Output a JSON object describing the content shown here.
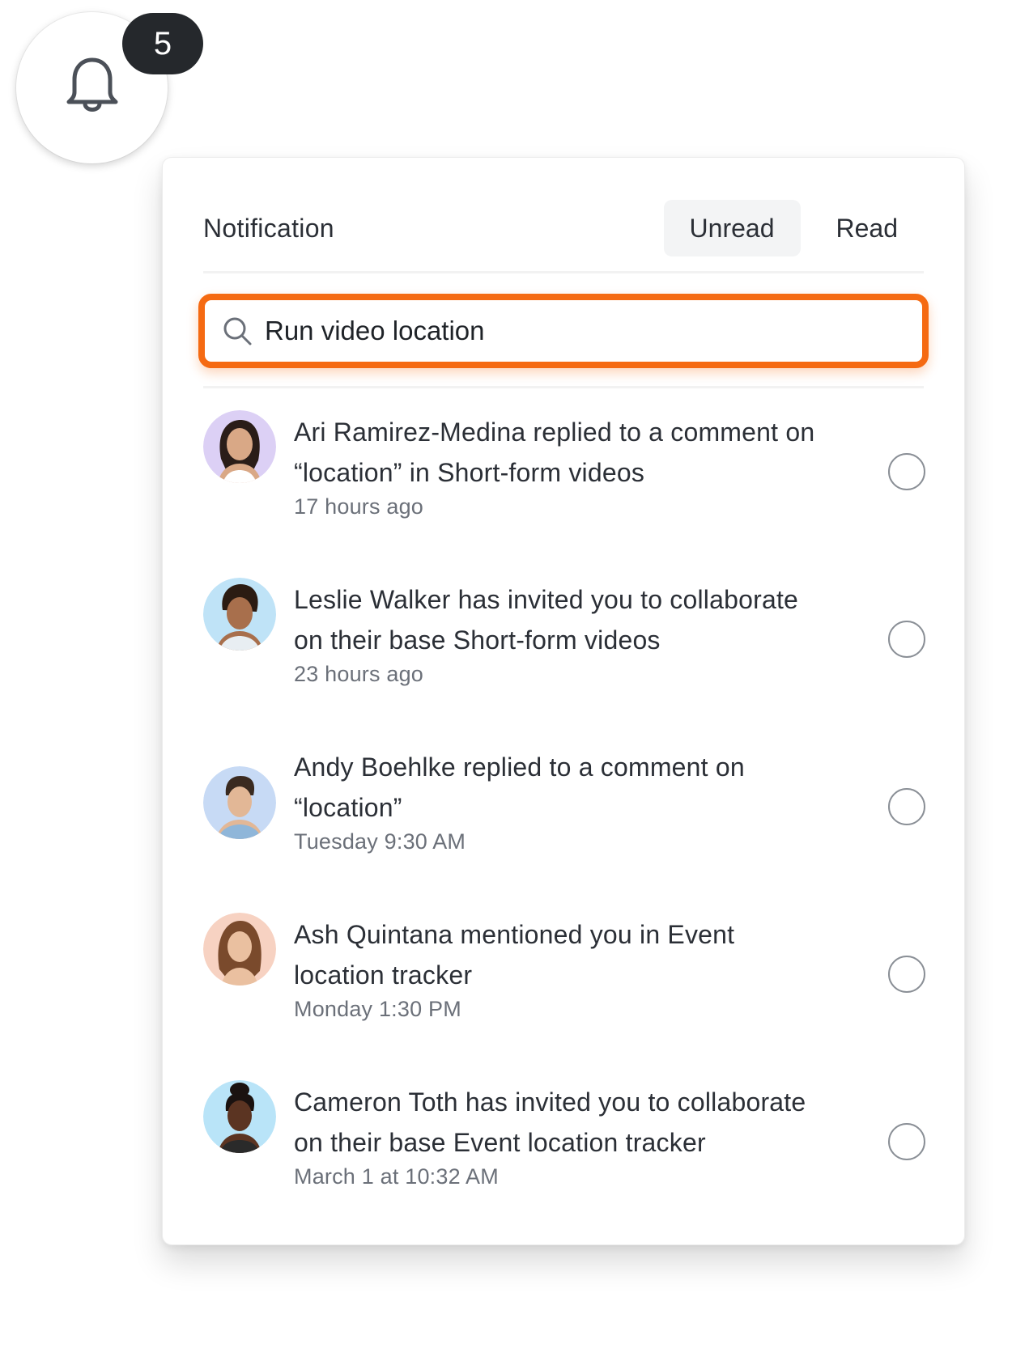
{
  "bell": {
    "badge_count": "5"
  },
  "panel": {
    "title": "Notification",
    "tabs": [
      {
        "label": "Unread",
        "active": true
      },
      {
        "label": "Read",
        "active": false
      }
    ],
    "search": {
      "value": "Run video location",
      "placeholder": ""
    }
  },
  "notifications": [
    {
      "message_line1": "Ari Ramirez-Medina replied to a comment on",
      "message_line2": "“location” in Short-form videos",
      "time": "17 hours ago",
      "avatar_bg": "#dcd0f5"
    },
    {
      "message_line1": "Leslie Walker has invited you to collaborate",
      "message_line2": "on their base Short-form videos",
      "time": "23 hours ago",
      "avatar_bg": "#bfe3f7"
    },
    {
      "message_line1": "Andy Boehlke replied to a comment on",
      "message_line2": "“location”",
      "time": "Tuesday 9:30 AM",
      "avatar_bg": "#c7daf5"
    },
    {
      "message_line1": "Ash Quintana mentioned you in Event",
      "message_line2": "location tracker",
      "time": "Monday 1:30 PM",
      "avatar_bg": "#f7d2c2"
    },
    {
      "message_line1": "Cameron Toth has invited you to collaborate",
      "message_line2": "on their base Event location tracker",
      "time": "March 1 at 10:32 AM",
      "avatar_bg": "#b9e4f8"
    }
  ],
  "colors": {
    "accent": "#f56a12",
    "badge": "#25282c",
    "text": "#2b2f36",
    "muted": "#6b7079"
  }
}
